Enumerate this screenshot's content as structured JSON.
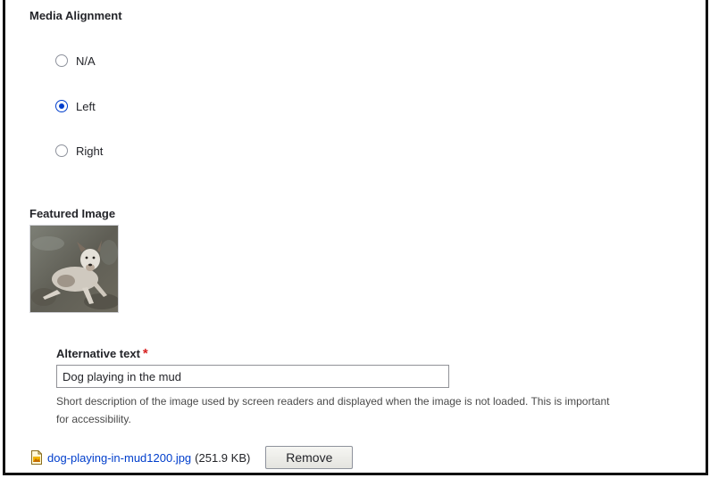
{
  "media_alignment": {
    "label": "Media Alignment",
    "options": [
      {
        "label": "N/A",
        "checked": false
      },
      {
        "label": "Left",
        "checked": true
      },
      {
        "label": "Right",
        "checked": false
      }
    ]
  },
  "featured_image": {
    "label": "Featured Image",
    "thumbnail": "dog-lying-in-mud-photo",
    "alt_text": {
      "label": "Alternative text",
      "required_marker": "*",
      "value": "Dog playing in the mud",
      "help": "Short description of the image used by screen readers and displayed when the image is not loaded. This is important for accessibility."
    },
    "file": {
      "icon": "image-file-icon",
      "name": "dog-playing-in-mud1200.jpg",
      "size": "(251.9 KB)"
    },
    "remove_label": "Remove"
  },
  "colors": {
    "link": "#003ecc",
    "required": "#d72222",
    "radio_checked": "#003ecc"
  }
}
